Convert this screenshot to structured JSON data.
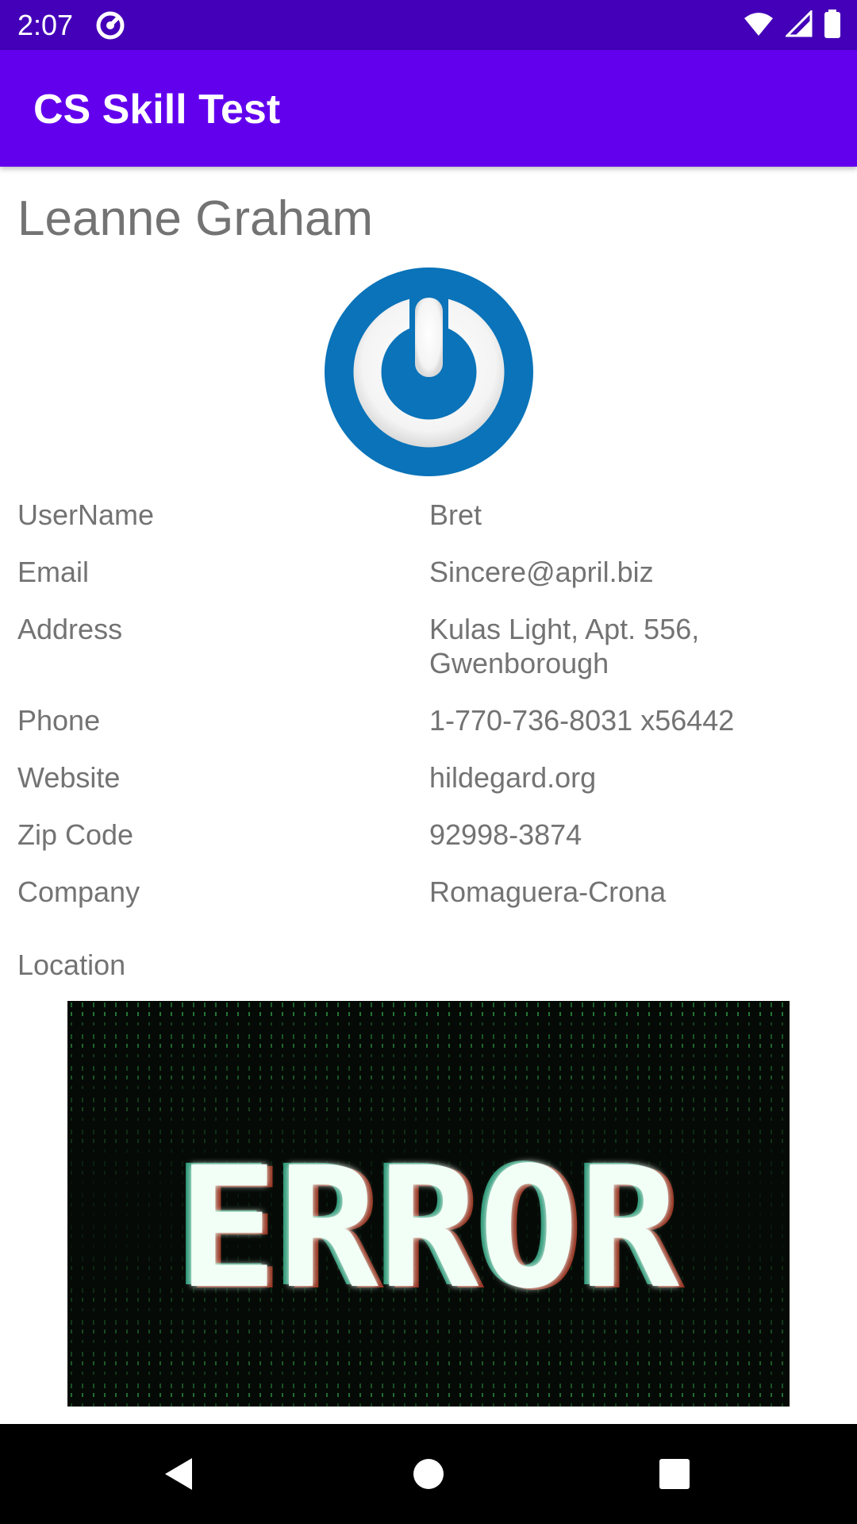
{
  "status_bar": {
    "time": "2:07",
    "icons": [
      "app-notification-icon",
      "wifi-icon",
      "signal-icon",
      "battery-icon"
    ]
  },
  "app_bar": {
    "title": "CS Skill Test",
    "color": "#6200ee"
  },
  "profile": {
    "name": "Leanne Graham",
    "avatar_icon": "power-icon",
    "fields": [
      {
        "label": "UserName",
        "value": "Bret"
      },
      {
        "label": "Email",
        "value": "Sincere@april.biz"
      },
      {
        "label": "Address",
        "value": "Kulas Light, Apt. 556, Gwenborough"
      },
      {
        "label": "Phone",
        "value": "1-770-736-8031 x56442"
      },
      {
        "label": "Website",
        "value": "hildegard.org"
      },
      {
        "label": "Zip Code",
        "value": "92998-3874"
      },
      {
        "label": "Company",
        "value": "Romaguera-Crona"
      }
    ],
    "location_label": "Location",
    "location_image_text": "ERROR"
  },
  "nav_bar": {
    "buttons": [
      "back-icon",
      "home-icon",
      "recents-icon"
    ]
  }
}
